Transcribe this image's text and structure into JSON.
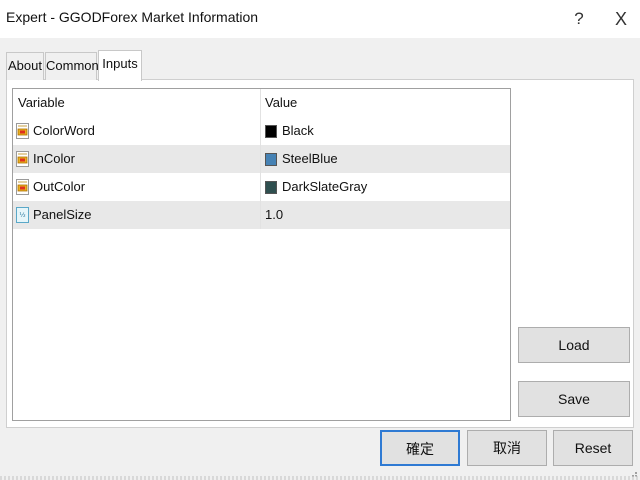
{
  "window": {
    "title": "Expert - GGODForex Market Information",
    "help_glyph": "?",
    "close_glyph": "X"
  },
  "tabs": [
    {
      "label": "About"
    },
    {
      "label": "Common"
    },
    {
      "label": "Inputs",
      "active": true
    }
  ],
  "grid": {
    "columns": [
      "Variable",
      "Value"
    ],
    "rows": [
      {
        "variable": "ColorWord",
        "value": "Black",
        "icon": "color-variable-icon",
        "swatch": "#000000"
      },
      {
        "variable": "InColor",
        "value": "SteelBlue",
        "icon": "color-variable-icon",
        "swatch": "#4682b4"
      },
      {
        "variable": "OutColor",
        "value": "DarkSlateGray",
        "icon": "color-variable-icon",
        "swatch": "#2f4f4f"
      },
      {
        "variable": "PanelSize",
        "value": "1.0",
        "icon": "numeric-variable-icon"
      }
    ]
  },
  "buttons": {
    "load": "Load",
    "save": "Save",
    "ok": "確定",
    "cancel": "取消",
    "reset": "Reset"
  },
  "colors": {
    "accent": "#2f7ad3",
    "alt_row": "#e8e8e8"
  }
}
